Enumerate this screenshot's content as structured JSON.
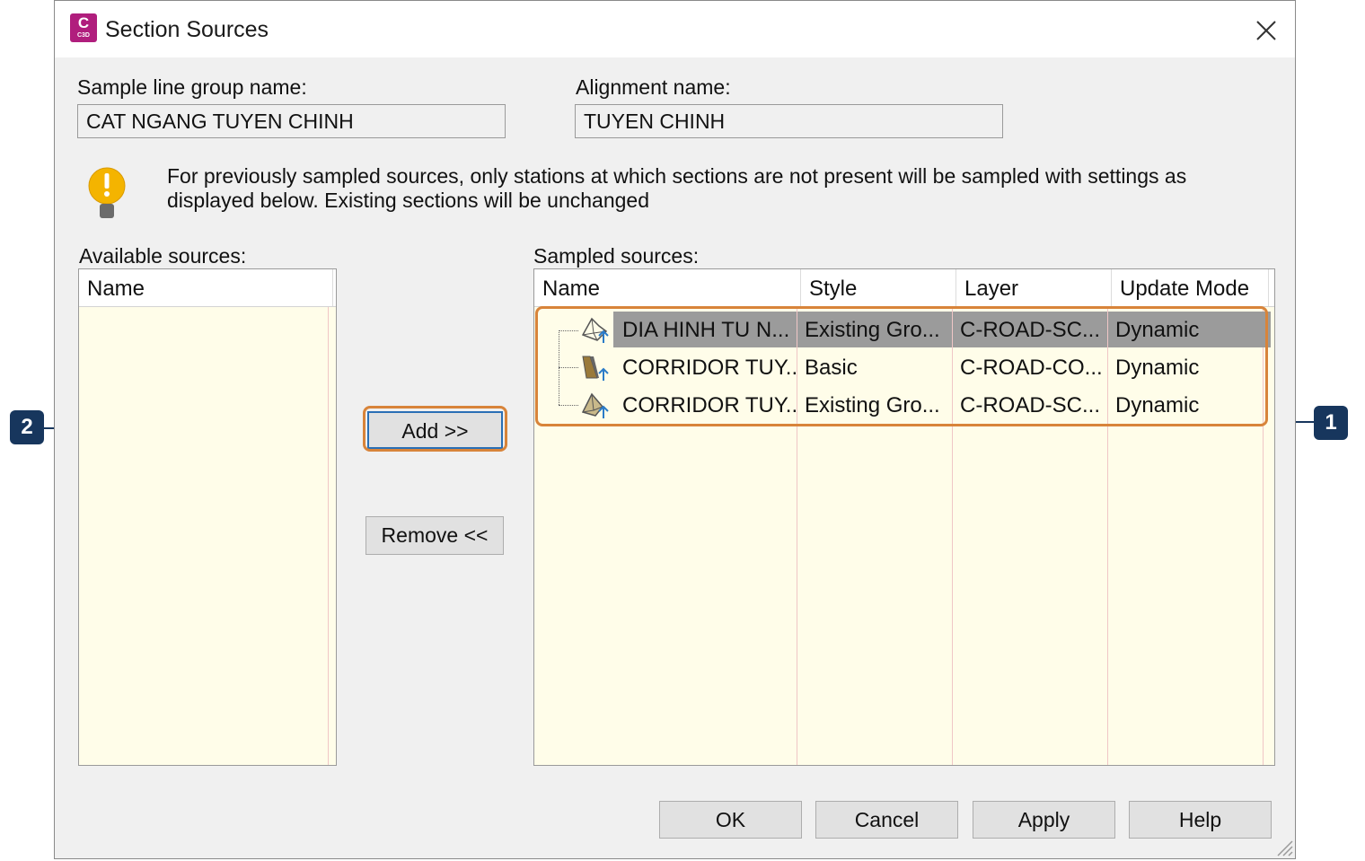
{
  "window": {
    "title": "Section Sources",
    "app_icon_text": "C",
    "app_icon_subtext": "C3D"
  },
  "fields": {
    "group_label": "Sample line group name:",
    "group_value": "CAT NGANG TUYEN CHINH",
    "alignment_label": "Alignment name:",
    "alignment_value": "TUYEN CHINH"
  },
  "message": "For previously sampled sources, only stations at which sections are not present will be sampled with settings as displayed below. Existing sections will be unchanged",
  "available": {
    "label": "Available sources:",
    "column": "Name"
  },
  "sampled": {
    "label": "Sampled sources:",
    "columns": [
      "Name",
      "Style",
      "Layer",
      "Update Mode"
    ],
    "rows": [
      {
        "name": "DIA HINH TU N...",
        "style": "Existing Gro...",
        "layer": "C-ROAD-SC...",
        "mode": "Dynamic",
        "icon": "surface-icon"
      },
      {
        "name": "CORRIDOR TUY...",
        "style": "Basic",
        "layer": "C-ROAD-CO...",
        "mode": "Dynamic",
        "icon": "corridor-icon"
      },
      {
        "name": "CORRIDOR TUY...",
        "style": "Existing Gro...",
        "layer": "C-ROAD-SC...",
        "mode": "Dynamic",
        "icon": "corridor-surface-icon"
      }
    ]
  },
  "buttons": {
    "add": "Add >>",
    "remove": "Remove <<",
    "ok": "OK",
    "cancel": "Cancel",
    "apply": "Apply",
    "help": "Help"
  },
  "callouts": {
    "one": "1",
    "two": "2"
  },
  "colors": {
    "highlight": "#d8843a",
    "callout": "#17365d",
    "list_bg": "#fffde9",
    "selected_row": "#9b9b9b"
  }
}
